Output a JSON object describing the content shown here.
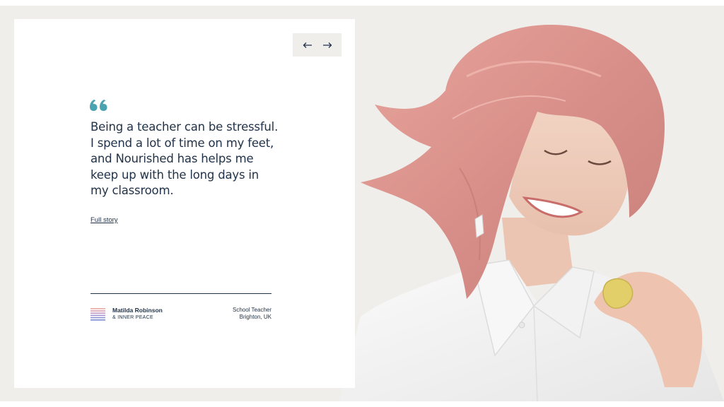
{
  "testimonial": {
    "quote": "Being a teacher can be stressful. I spend a lot of time on my feet, and Nourished has helps me keep up with the long days in my classroom.",
    "link_label": "Full story"
  },
  "author": {
    "name": "Matilda Robinson",
    "brand": "& INNER PEACE",
    "role": "School Teacher",
    "location": "Brighton, UK"
  },
  "navigation": {
    "prev_icon": "arrow-left-icon",
    "next_icon": "arrow-right-icon"
  },
  "colors": {
    "background": "#efeeeb",
    "card": "#ffffff",
    "text": "#223349",
    "accent": "#4aa3b1"
  }
}
